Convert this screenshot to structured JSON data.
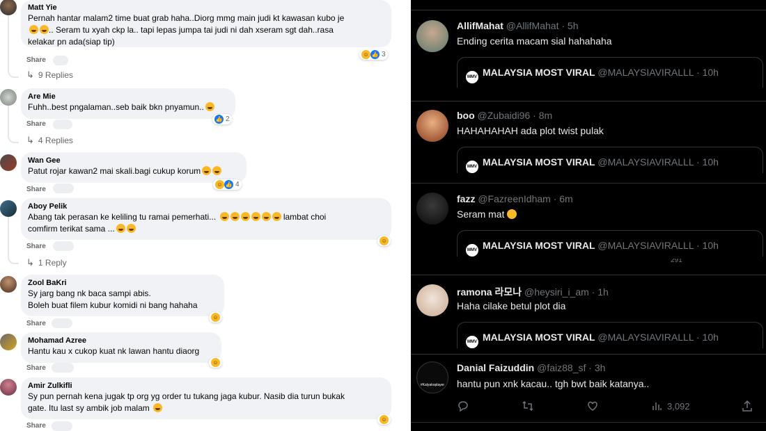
{
  "facebook": {
    "share_label": "Share",
    "comments": [
      {
        "name": "Matt Yie",
        "text": "Pernah hantar malam2 time buat grab haha..Diorg mmg main judi kt kawasan kubo je",
        "text2": ".. Seram tu xyah ckp la.. tapi lepas jumpa tai judi ni dah xseram sgt dah..rasa",
        "text3": "kelakar pn ada(siap tip)",
        "reaction_count": "3",
        "replies": "9 Replies"
      },
      {
        "name": "Are Mie",
        "text": "Fuhh..best pngalaman..seb baik bkn pnyamun..",
        "reaction_count": "2",
        "replies": "4 Replies"
      },
      {
        "name": "Wan Gee",
        "text": "Patut rojar kawan2 mai skali.bagi cukup korum",
        "reaction_count": "4"
      },
      {
        "name": "Aboy Pelik",
        "text": "Abang tak perasan ke keliling tu ramai pemerhati...",
        "text_b": "lambat choi",
        "text2": "comfirm terikat sama ...",
        "replies": "1 Reply"
      },
      {
        "name": "Zool BaKri",
        "text": "Sy jarg bang nk baca sampi abis.",
        "text2": "Boleh buat filem kubur komidi ni bang hahaha"
      },
      {
        "name": "Mohamad Azree",
        "text": "Hantu kau x cukop kuat nk lawan hantu diaorg"
      },
      {
        "name": "Amir Zulkifli",
        "text": "Sy pun pernah kena jugak tp org yg order tu tukang jaga kubur. Nasib dia turun bukak",
        "text2": "gate. Itu last sy ambik job malam"
      }
    ]
  },
  "twitter": {
    "quote_name": "MALAYSIA MOST VIRAL",
    "quote_handle": "@MALAYSIAVIRALLL · 10h",
    "logo_text": "MMV",
    "tweets": [
      {
        "name": "AllifMahat",
        "handle": "@AllifMahat · 5h",
        "text": "Ending cerita macam sial hahahaha"
      },
      {
        "name": "boo",
        "handle": "@Zubaidi96 · 8m",
        "text": "HAHAHAHAH ada plot twist pulak"
      },
      {
        "name": "fazz",
        "handle": "@FazreenIdham · 6m",
        "text": "Seram mat"
      },
      {
        "name": "ramona 라모나",
        "handle": "@heysiri_i_am · 1h",
        "text": "Haha cilake betul plot dia"
      },
      {
        "name": "Danial Faizuddin",
        "handle": "@faiz88_sf · 3h",
        "text": "hantu pun xnk kacau.. tgh bwt baik katanya..",
        "views": "3,092",
        "avatar_text": "#Kalyakoplayer"
      }
    ],
    "ghost_count": "291"
  }
}
